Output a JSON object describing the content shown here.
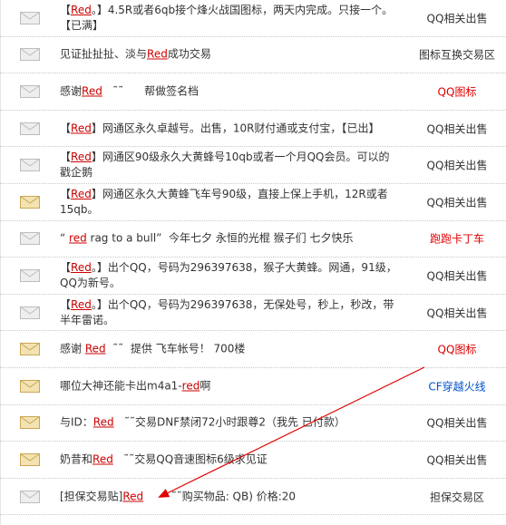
{
  "icon": "envelope-icon",
  "colors": {
    "link": "#cc0000",
    "cat_red": "#e00000",
    "cat_blue": "#0050c8",
    "arrow": "#e00000"
  },
  "rows": [
    {
      "segments": [
        {
          "t": "t",
          "v": "【"
        },
        {
          "t": "u",
          "v": "Red"
        },
        {
          "t": "t",
          "v": "。】4.5R或者6qb接个烽火战国图标，两天内完成。只接一个。【已满】"
        }
      ],
      "category": "QQ相关出售",
      "cat_color": "normal",
      "icon_state": "read"
    },
    {
      "segments": [
        {
          "t": "t",
          "v": "见证扯扯扯、淡与"
        },
        {
          "t": "u",
          "v": "Red"
        },
        {
          "t": "t",
          "v": "成功交易"
        }
      ],
      "category": "图标互换交易区",
      "cat_color": "normal",
      "icon_state": "read"
    },
    {
      "segments": [
        {
          "t": "t",
          "v": "感谢"
        },
        {
          "t": "u",
          "v": "Red"
        },
        {
          "t": "t",
          "v": "   ˜˜      帮做签名档"
        }
      ],
      "category": "QQ图标",
      "cat_color": "red",
      "icon_state": "read"
    },
    {
      "segments": [
        {
          "t": "t",
          "v": "【"
        },
        {
          "t": "u",
          "v": "Red"
        },
        {
          "t": "t",
          "v": "】网通区永久卓越号。出售，10R财付通或支付宝，【已出】"
        }
      ],
      "category": "QQ相关出售",
      "cat_color": "normal",
      "icon_state": "read"
    },
    {
      "segments": [
        {
          "t": "t",
          "v": "【"
        },
        {
          "t": "u",
          "v": "Red"
        },
        {
          "t": "t",
          "v": "】网通区90级永久大黄蜂号10qb或者一个月QQ会员。可以的戳企鹅"
        }
      ],
      "category": "QQ相关出售",
      "cat_color": "normal",
      "icon_state": "read"
    },
    {
      "segments": [
        {
          "t": "t",
          "v": "【"
        },
        {
          "t": "u",
          "v": "Red"
        },
        {
          "t": "t",
          "v": "】网通区永久大黄蜂飞车号90级，直接上保上手机，12R或者15qb。"
        }
      ],
      "category": "QQ相关出售",
      "cat_color": "normal",
      "icon_state": "new"
    },
    {
      "segments": [
        {
          "t": "t",
          "v": "“ "
        },
        {
          "t": "u",
          "v": "red"
        },
        {
          "t": "t",
          "v": " rag to a bull”  今年七夕 永恒的光棍 猴子们 七夕快乐"
        }
      ],
      "category": "跑跑卡丁车",
      "cat_color": "red",
      "icon_state": "read"
    },
    {
      "segments": [
        {
          "t": "t",
          "v": "【"
        },
        {
          "t": "u",
          "v": "Red"
        },
        {
          "t": "t",
          "v": "。】出个QQ，号码为296397638，猴子大黄蜂。网通，91级，QQ为新号。"
        }
      ],
      "category": "QQ相关出售",
      "cat_color": "normal",
      "icon_state": "read"
    },
    {
      "segments": [
        {
          "t": "t",
          "v": "【"
        },
        {
          "t": "u",
          "v": "Red"
        },
        {
          "t": "t",
          "v": "。】出个QQ，号码为296397638，无保处号，秒上，秒改，带半年雷诺。"
        }
      ],
      "category": "QQ相关出售",
      "cat_color": "normal",
      "icon_state": "read"
    },
    {
      "segments": [
        {
          "t": "t",
          "v": "感谢 "
        },
        {
          "t": "u",
          "v": "Red"
        },
        {
          "t": "t",
          "v": "  ˜˜  提供 飞车帐号！ 700楼"
        }
      ],
      "category": "QQ图标",
      "cat_color": "red",
      "icon_state": "new"
    },
    {
      "segments": [
        {
          "t": "t",
          "v": "哪位大神还能卡出m4a1-"
        },
        {
          "t": "u",
          "v": "red"
        },
        {
          "t": "t",
          "v": "啊"
        }
      ],
      "category": "CF穿越火线",
      "cat_color": "blue",
      "icon_state": "new"
    },
    {
      "segments": [
        {
          "t": "t",
          "v": "与ID："
        },
        {
          "t": "u",
          "v": "Red"
        },
        {
          "t": "t",
          "v": "   ˜˜交易DNF禁闭72小时跟尊2（我先 已付款）"
        }
      ],
      "category": "QQ相关出售",
      "cat_color": "normal",
      "icon_state": "new"
    },
    {
      "segments": [
        {
          "t": "t",
          "v": "奶昔和"
        },
        {
          "t": "u",
          "v": "Red"
        },
        {
          "t": "t",
          "v": "   ˜˜交易QQ音速图标6级求见证"
        }
      ],
      "category": "QQ相关出售",
      "cat_color": "normal",
      "icon_state": "new"
    },
    {
      "segments": [
        {
          "t": "t",
          "v": "[担保交易贴]"
        },
        {
          "t": "u",
          "v": "Red"
        },
        {
          "t": "t",
          "v": "        ˜˜购买物品: QB) 价格:20"
        }
      ],
      "category": "担保交易区",
      "cat_color": "normal",
      "icon_state": "read"
    }
  ]
}
